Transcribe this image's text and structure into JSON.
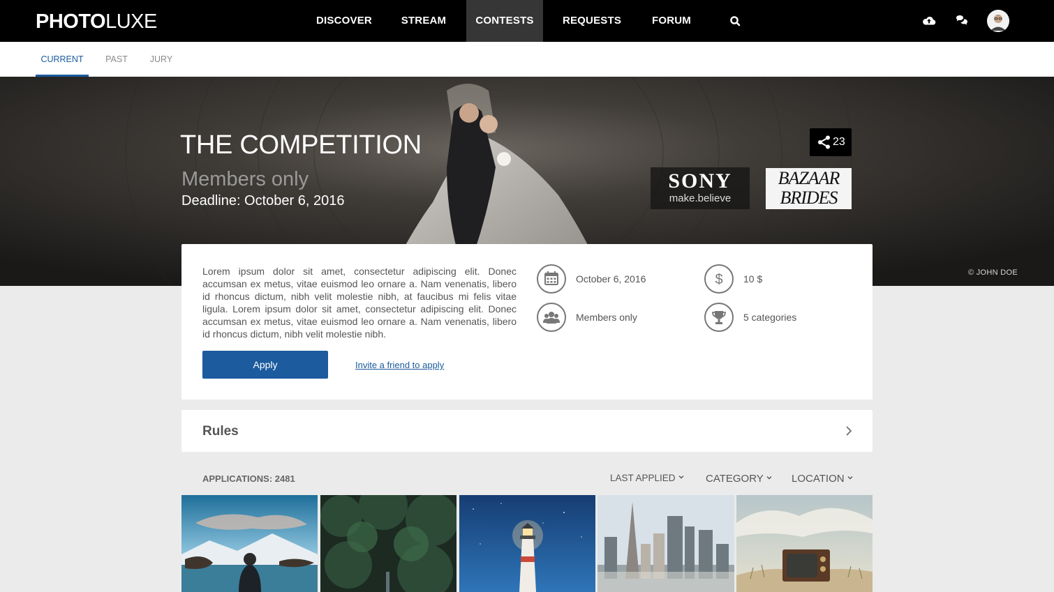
{
  "brand": {
    "bold": "PHOTO",
    "light": "LUXE"
  },
  "nav": {
    "discover": "DISCOVER",
    "stream": "STREAM",
    "contests": "CONTESTS",
    "requests": "REQUESTS",
    "forum": "FORUM"
  },
  "subtabs": {
    "current": "CURRENT",
    "past": "PAST",
    "jury": "JURY"
  },
  "hero": {
    "title": "THE COMPETITION",
    "subtitle": "Members only",
    "deadline": "Deadline: October 6, 2016",
    "share_count": "23",
    "credit": "© JOHN DOE",
    "sponsors": {
      "sony_name": "SONY",
      "sony_tagline": "make.believe",
      "bazaar_line1": "BAZAAR",
      "bazaar_line2": "BRIDES"
    }
  },
  "info": {
    "description": "Lorem ipsum dolor sit amet, consectetur adipiscing elit. Donec accumsan ex metus, vitae euismod leo ornare a. Nam venenatis, libero id rhoncus dictum, nibh velit molestie nibh, at faucibus mi felis vitae ligula. Lorem ipsum dolor sit amet, consectetur adipiscing elit. Donec accumsan ex metus, vitae euismod leo ornare a. Nam venenatis, libero id rhoncus dictum, nibh velit molestie nibh.",
    "apply_label": "Apply",
    "invite_label": "Invite a friend to apply",
    "date": "October 6, 2016",
    "fee": "10 $",
    "access": "Members only",
    "categories": "5 categories"
  },
  "rules": {
    "label": "Rules"
  },
  "applications": {
    "label": "APPLICATIONS: 2481",
    "filters": {
      "last_applied": "LAST APPLIED",
      "category": "CATEGORY",
      "location": "LOCATION"
    }
  },
  "icons": {
    "search": "search-icon",
    "upload": "cloud-upload-icon",
    "chat": "chat-icon",
    "share": "share-icon",
    "calendar": "calendar-icon",
    "dollar": "dollar-icon",
    "group": "group-icon",
    "trophy": "trophy-icon",
    "chevron": "chevron-right-icon"
  },
  "colors": {
    "accent": "#1b5b9e",
    "nav_bg": "#000000",
    "nav_active": "#363636",
    "page_bg": "#ebebeb"
  }
}
